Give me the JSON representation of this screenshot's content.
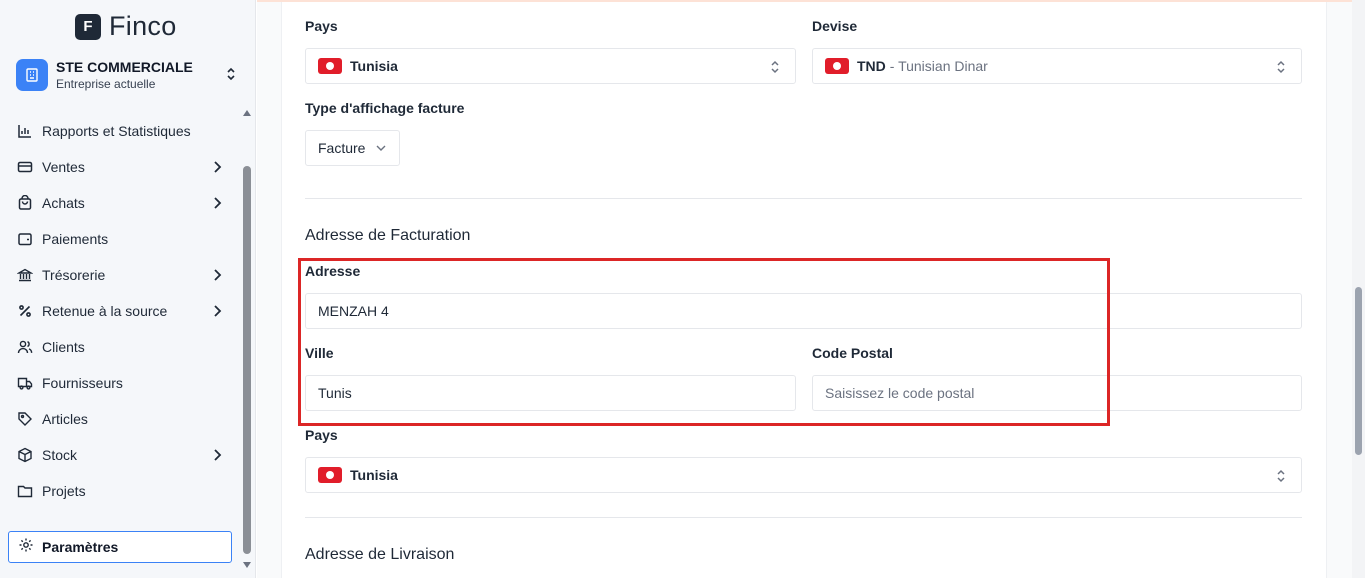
{
  "app": {
    "logo_letter": "F",
    "name": "Finco"
  },
  "company": {
    "name": "STE COMMERCIALE",
    "subtitle": "Entreprise actuelle"
  },
  "nav": [
    {
      "label": "Rapports et Statistiques",
      "icon": "bar-chart-icon",
      "has_arrow": false
    },
    {
      "label": "Ventes",
      "icon": "card-icon",
      "has_arrow": true
    },
    {
      "label": "Achats",
      "icon": "shopping-bag-icon",
      "has_arrow": true
    },
    {
      "label": "Paiements",
      "icon": "wallet-icon",
      "has_arrow": false
    },
    {
      "label": "Trésorerie",
      "icon": "bank-icon",
      "has_arrow": true
    },
    {
      "label": "Retenue à la source",
      "icon": "percent-icon",
      "has_arrow": true
    },
    {
      "label": "Clients",
      "icon": "users-icon",
      "has_arrow": false
    },
    {
      "label": "Fournisseurs",
      "icon": "truck-icon",
      "has_arrow": false
    },
    {
      "label": "Articles",
      "icon": "tag-icon",
      "has_arrow": false
    },
    {
      "label": "Stock",
      "icon": "box-icon",
      "has_arrow": true
    },
    {
      "label": "Projets",
      "icon": "folder-icon",
      "has_arrow": false
    }
  ],
  "settings": {
    "label": "Paramètres",
    "icon": "gear-icon"
  },
  "form": {
    "pays": {
      "label": "Pays",
      "value": "Tunisia"
    },
    "devise": {
      "label": "Devise",
      "code": "TND",
      "name": "- Tunisian Dinar"
    },
    "type_affichage": {
      "label": "Type d'affichage facture",
      "value": "Facture"
    },
    "facturation": {
      "title": "Adresse de Facturation",
      "adresse": {
        "label": "Adresse",
        "value": "MENZAH 4"
      },
      "ville": {
        "label": "Ville",
        "value": "Tunis"
      },
      "code_postal": {
        "label": "Code Postal",
        "value": "",
        "placeholder": "Saisissez le code postal"
      },
      "pays": {
        "label": "Pays",
        "value": "Tunisia"
      }
    },
    "livraison": {
      "title": "Adresse de Livraison"
    }
  },
  "colors": {
    "accent": "#3b82f6",
    "highlight": "#dc2626",
    "flag_red": "#e11d2a"
  }
}
